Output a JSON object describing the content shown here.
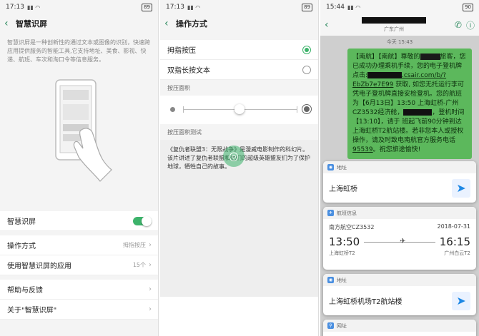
{
  "screen1": {
    "status": {
      "time": "17:13",
      "battery": "89"
    },
    "title": "智慧识屏",
    "description": "智慧识屏是一种创新性的通过文本或图像的识别，快速跨应用提供服务的智能工具,它支持地址、美食、影视、快递、航班、车次和淘口令等信息服务。",
    "rows": {
      "smart_screen": "智慧识屏",
      "operation_mode": "操作方式",
      "operation_mode_value": "拇指按压",
      "apps_using": "使用智慧识屏的应用",
      "apps_count": "15个",
      "help": "帮助与反馈",
      "about": "关于\"智慧识屏\""
    },
    "toggle_on": true
  },
  "screen2": {
    "status": {
      "time": "17:13",
      "battery": "89"
    },
    "title": "操作方式",
    "options": [
      {
        "label": "拇指按压",
        "selected": true
      },
      {
        "label": "双指长按文本",
        "selected": false
      }
    ],
    "pressure_area_label": "按压面积",
    "test_label": "按压面积测试",
    "test_text": "《复仇者联盟3：无限战争》是漫威电影制作的科幻片。该片讲述了复仇者联盟和他们的超级英雄盟友们为了保护地球，牺牲自己的故事。"
  },
  "screen3": {
    "status": {
      "time": "15:44",
      "battery": "90"
    },
    "chat_sub": "广东广州",
    "date_label": "今天 15:43",
    "message": {
      "p1": "【南航】【南航】尊敬的",
      "p2": "旅客，您已成功办理乘机手续，您的电子登机牌点击:",
      "p3": ".csair.com/b/?EbZb7e7E99",
      "p4": "获取, 如您无托运行李可凭电子登机牌直接安检登机。您的航班为【6月13日】13:50 上海虹桥-广州 CZ3532经济舱，",
      "p5": "，登机时间【13:10】，请于 班起飞前90分钟到达上海虹桥T2航站楼。若非您本人或授权操作，请及时致电南航官方服务电话",
      "phone": "95539",
      "p6": "。祝您旅途愉快!"
    },
    "card_address1": {
      "header": "地址",
      "body": "上海虹桥"
    },
    "card_flight": {
      "header": "航班信息",
      "airline": "南方航空CZ3532",
      "date": "2018-07-31",
      "dep_time": "13:50",
      "arr_time": "16:15",
      "dep_airport": "上海虹桥T2",
      "arr_airport": "广州白云T2"
    },
    "card_address2": {
      "header": "地址",
      "body": "上海虹桥机场T2航站楼"
    },
    "card_url": {
      "header": "网址"
    }
  },
  "colors": {
    "accent_green": "#3db36b",
    "sms_bubble": "#5cb85c",
    "link_blue": "#1e88e5"
  }
}
